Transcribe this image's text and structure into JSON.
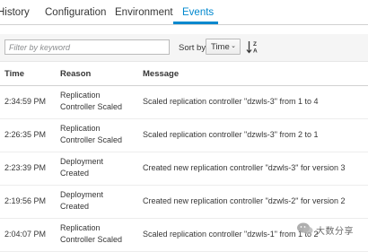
{
  "tabs": [
    {
      "label": "History"
    },
    {
      "label": "Configuration"
    },
    {
      "label": "Environment"
    },
    {
      "label": "Events",
      "active": true
    }
  ],
  "toolbar": {
    "filter_placeholder": "Filter by keyword",
    "filter_value": "",
    "sort_by_label": "Sort by",
    "sort_field": "Time",
    "sort_direction": "descending"
  },
  "table": {
    "headers": [
      "Time",
      "Reason",
      "Message"
    ],
    "rows": [
      {
        "time": "2:34:59 PM",
        "reason_line1": "Replication",
        "reason_line2": "Controller Scaled",
        "message": "Scaled replication controller \"dzwls-3\" from 1 to 4"
      },
      {
        "time": "2:26:35 PM",
        "reason_line1": "Replication",
        "reason_line2": "Controller Scaled",
        "message": "Scaled replication controller \"dzwls-3\" from 2 to 1"
      },
      {
        "time": "2:23:39 PM",
        "reason_line1": "Deployment",
        "reason_line2": "Created",
        "message": "Created new replication controller \"dzwls-3\" for version 3"
      },
      {
        "time": "2:19:56 PM",
        "reason_line1": "Deployment",
        "reason_line2": "Created",
        "message": "Created new replication controller \"dzwls-2\" for version 2"
      },
      {
        "time": "2:04:07 PM",
        "reason_line1": "Replication",
        "reason_line2": "Controller Scaled",
        "message": "Scaled replication controller \"dzwls-1\" from 1 to 2"
      }
    ]
  },
  "watermark": {
    "text": "大数分享"
  },
  "colors": {
    "accent": "#0088ce",
    "text": "#363636",
    "toolbar_bg": "#f5f5f5"
  }
}
